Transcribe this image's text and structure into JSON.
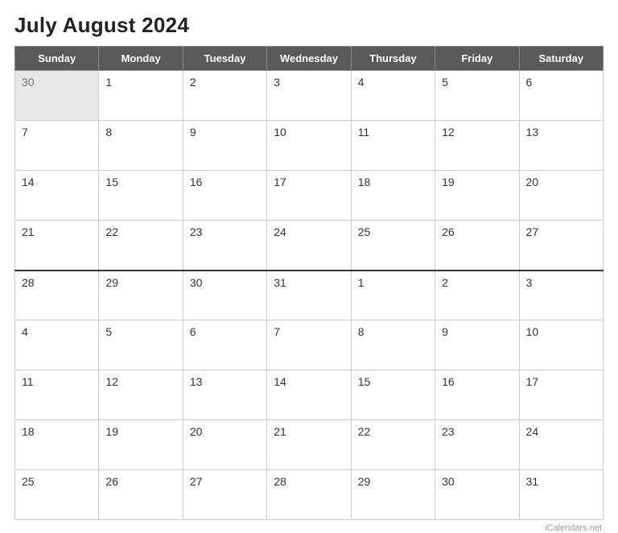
{
  "title": "July August 2024",
  "colors": {
    "header_bg": "#5a5a5a",
    "grayed_bg": "#e8e8e8",
    "border": "#cccccc"
  },
  "watermark": "iCalendars.net",
  "headers": [
    "Sunday",
    "Monday",
    "Tuesday",
    "Wednesday",
    "Thursday",
    "Friday",
    "Saturday"
  ],
  "weeks": [
    [
      {
        "day": "30",
        "grayed": true
      },
      {
        "day": "1",
        "grayed": false
      },
      {
        "day": "2",
        "grayed": false
      },
      {
        "day": "3",
        "grayed": false
      },
      {
        "day": "4",
        "grayed": false
      },
      {
        "day": "5",
        "grayed": false
      },
      {
        "day": "6",
        "grayed": false
      }
    ],
    [
      {
        "day": "7",
        "grayed": false
      },
      {
        "day": "8",
        "grayed": false
      },
      {
        "day": "9",
        "grayed": false
      },
      {
        "day": "10",
        "grayed": false
      },
      {
        "day": "11",
        "grayed": false
      },
      {
        "day": "12",
        "grayed": false
      },
      {
        "day": "13",
        "grayed": false
      }
    ],
    [
      {
        "day": "14",
        "grayed": false
      },
      {
        "day": "15",
        "grayed": false
      },
      {
        "day": "16",
        "grayed": false
      },
      {
        "day": "17",
        "grayed": false
      },
      {
        "day": "18",
        "grayed": false
      },
      {
        "day": "19",
        "grayed": false
      },
      {
        "day": "20",
        "grayed": false
      }
    ],
    [
      {
        "day": "21",
        "grayed": false
      },
      {
        "day": "22",
        "grayed": false
      },
      {
        "day": "23",
        "grayed": false
      },
      {
        "day": "24",
        "grayed": false
      },
      {
        "day": "25",
        "grayed": false
      },
      {
        "day": "26",
        "grayed": false
      },
      {
        "day": "27",
        "grayed": false
      }
    ],
    [
      {
        "day": "28",
        "grayed": false
      },
      {
        "day": "29",
        "grayed": false
      },
      {
        "day": "30",
        "grayed": false
      },
      {
        "day": "31",
        "grayed": false
      },
      {
        "day": "1",
        "grayed": false,
        "month_break": true
      },
      {
        "day": "2",
        "grayed": false
      },
      {
        "day": "3",
        "grayed": false
      }
    ],
    [
      {
        "day": "4",
        "grayed": false
      },
      {
        "day": "5",
        "grayed": false
      },
      {
        "day": "6",
        "grayed": false
      },
      {
        "day": "7",
        "grayed": false
      },
      {
        "day": "8",
        "grayed": false
      },
      {
        "day": "9",
        "grayed": false
      },
      {
        "day": "10",
        "grayed": false
      }
    ],
    [
      {
        "day": "11",
        "grayed": false
      },
      {
        "day": "12",
        "grayed": false
      },
      {
        "day": "13",
        "grayed": false
      },
      {
        "day": "14",
        "grayed": false
      },
      {
        "day": "15",
        "grayed": false
      },
      {
        "day": "16",
        "grayed": false
      },
      {
        "day": "17",
        "grayed": false
      }
    ],
    [
      {
        "day": "18",
        "grayed": false
      },
      {
        "day": "19",
        "grayed": false
      },
      {
        "day": "20",
        "grayed": false
      },
      {
        "day": "21",
        "grayed": false
      },
      {
        "day": "22",
        "grayed": false
      },
      {
        "day": "23",
        "grayed": false
      },
      {
        "day": "24",
        "grayed": false
      }
    ],
    [
      {
        "day": "25",
        "grayed": false
      },
      {
        "day": "26",
        "grayed": false
      },
      {
        "day": "27",
        "grayed": false
      },
      {
        "day": "28",
        "grayed": false
      },
      {
        "day": "29",
        "grayed": false
      },
      {
        "day": "30",
        "grayed": false
      },
      {
        "day": "31",
        "grayed": false
      }
    ]
  ]
}
